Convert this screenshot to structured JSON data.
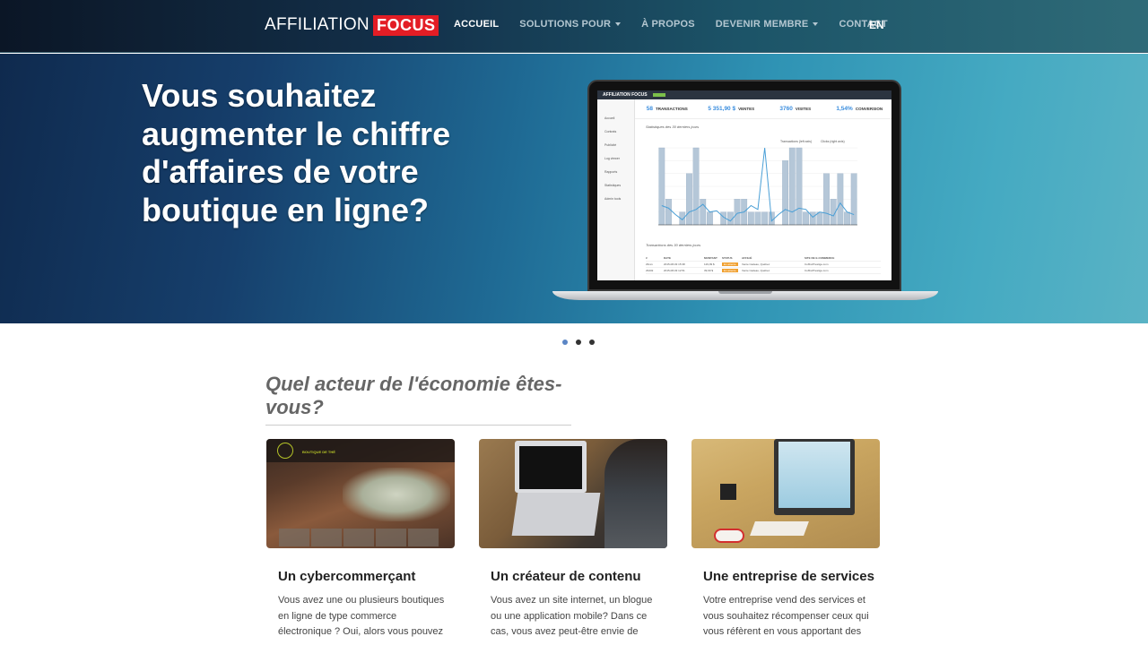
{
  "navbar": {
    "logo_light": "AFFILIATION",
    "logo_focus": "FOCUS",
    "items": [
      {
        "label": "ACCUEIL",
        "active": true,
        "dropdown": false
      },
      {
        "label": "SOLUTIONS POUR",
        "active": false,
        "dropdown": true
      },
      {
        "label": "À PROPOS",
        "active": false,
        "dropdown": false
      },
      {
        "label": "DEVENIR MEMBRE",
        "active": false,
        "dropdown": true
      },
      {
        "label": "CONTACT",
        "active": false,
        "dropdown": false
      }
    ],
    "language": "EN"
  },
  "hero": {
    "title": "Vous souhaitez augmenter le chiffre d'affaires de votre boutique en ligne?",
    "mockup": {
      "app_name": "AFFILIATION FOCUS",
      "kpis": [
        {
          "value": "58",
          "label": "TRANSACTIONS"
        },
        {
          "value": "5 351,90 $",
          "label": "VENTES"
        },
        {
          "value": "3760",
          "label": "VISITES"
        },
        {
          "value": "1,54%",
          "label": "CONVERSION"
        }
      ],
      "sidebar": [
        "Accueil",
        "Contrats",
        "Publicité",
        "Log viewer",
        "Rapports",
        "Statistiques",
        "Admin tools"
      ],
      "chart_title": "Statistiques des 30 derniers jours",
      "legend": [
        "Transactions (left axis)",
        "Clicks (right axis)"
      ],
      "chart_bars": [
        6,
        2,
        0,
        1,
        4,
        6,
        2,
        1,
        0,
        1,
        1,
        2,
        2,
        1,
        1,
        1,
        1,
        0,
        5,
        6,
        6,
        1,
        1,
        1,
        4,
        2,
        4,
        1,
        4
      ],
      "chart_line": [
        1.5,
        1.3,
        0.8,
        0.4,
        1.0,
        1.2,
        1.6,
        1.0,
        1.1,
        0.6,
        0.3,
        0.9,
        1.0,
        1.5,
        1.2,
        6.0,
        0.3,
        0.8,
        1.2,
        1.0,
        1.3,
        1.2,
        0.6,
        1.0,
        0.9,
        0.7,
        1.7,
        1.0,
        0.8
      ],
      "table_title": "Transactions des 30 derniers jours",
      "table_headers": [
        "#",
        "DATE",
        "MONTANT",
        "STATUS",
        "AFFILIÉ",
        "SITE DE E-COMMERCE"
      ],
      "table_rows": [
        [
          "29xxx",
          "2015-08-03 15:38",
          "129,99 $",
          "En attente",
          "Vente Cadeau, Québec",
          "CoffretPrestige.com"
        ],
        [
          "29432",
          "2015-08-03 12:51",
          "39,99 $",
          "En attente",
          "Vente Cadeau, Québec",
          "CoffretPrestige.com"
        ]
      ]
    }
  },
  "carousel": {
    "count": 3,
    "active_index": 0
  },
  "section": {
    "title": "Quel acteur de l'économie êtes-vous?",
    "cards": [
      {
        "title": "Un cybercommerçant",
        "lines": [
          "Vous avez une ou plusieurs boutiques",
          "en ligne de type commerce",
          "électronique ? Oui, alors vous pouvez"
        ],
        "image_label": "BOUTIQUE DE THÉ"
      },
      {
        "title": "Un créateur de contenu",
        "lines": [
          "Vous avez un site internet, un blogue",
          "ou une application mobile? Dans ce",
          "cas, vous avez peut-être envie de"
        ]
      },
      {
        "title": "Une entreprise de services",
        "lines": [
          "Votre entreprise vend des services et",
          "vous souhaitez récompenser ceux qui",
          "vous réfèrent en vous apportant des"
        ]
      }
    ]
  },
  "colors": {
    "brand_red": "#e31d25",
    "accent_blue": "#3a8dde",
    "dot_active": "#5b86c5",
    "status_orange": "#f0a030"
  }
}
